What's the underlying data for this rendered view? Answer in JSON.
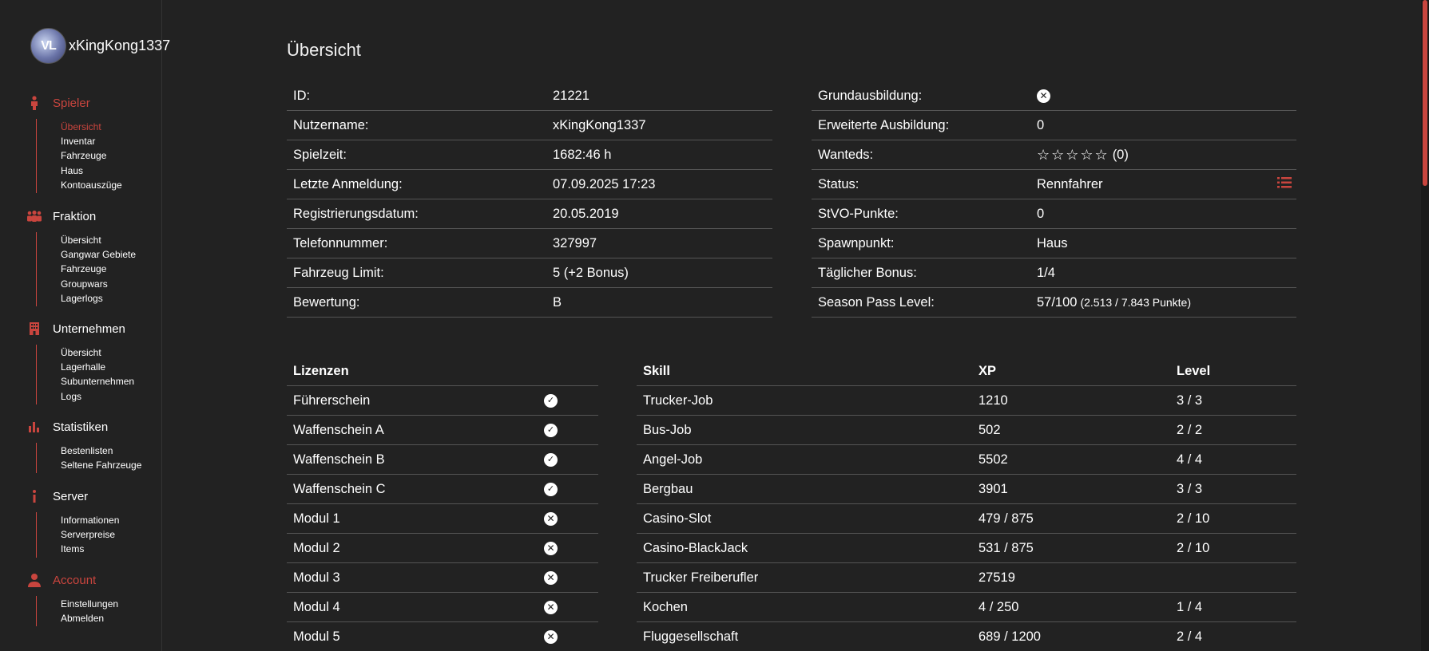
{
  "profile": {
    "avatar_text": "VL",
    "username": "xKingKong1337"
  },
  "sidebar": {
    "spieler": {
      "label": "Spieler",
      "items": [
        "Übersicht",
        "Inventar",
        "Fahrzeuge",
        "Haus",
        "Kontoauszüge"
      ]
    },
    "fraktion": {
      "label": "Fraktion",
      "items": [
        "Übersicht",
        "Gangwar Gebiete",
        "Fahrzeuge",
        "Groupwars",
        "Lagerlogs"
      ]
    },
    "unternehmen": {
      "label": "Unternehmen",
      "items": [
        "Übersicht",
        "Lagerhalle",
        "Subunternehmen",
        "Logs"
      ]
    },
    "statistiken": {
      "label": "Statistiken",
      "items": [
        "Bestenlisten",
        "Seltene Fahrzeuge"
      ]
    },
    "server": {
      "label": "Server",
      "items": [
        "Informationen",
        "Serverpreise",
        "Items"
      ]
    },
    "account": {
      "label": "Account",
      "items": [
        "Einstellungen",
        "Abmelden"
      ]
    }
  },
  "page_title": "Übersicht",
  "info_left": [
    {
      "k": "ID:",
      "v": "21221"
    },
    {
      "k": "Nutzername:",
      "v": "xKingKong1337"
    },
    {
      "k": "Spielzeit:",
      "v": "1682:46 h"
    },
    {
      "k": "Letzte Anmeldung:",
      "v": "07.09.2025 17:23"
    },
    {
      "k": "Registrierungsdatum:",
      "v": "20.05.2019"
    },
    {
      "k": "Telefonnummer:",
      "v": "327997"
    },
    {
      "k": "Fahrzeug Limit:",
      "v": "5 (+2 Bonus)"
    },
    {
      "k": "Bewertung:",
      "v": "B"
    }
  ],
  "info_right": {
    "grundausbildung": {
      "k": "Grundausbildung:",
      "state": "no"
    },
    "erweitert": {
      "k": "Erweiterte Ausbildung:",
      "v": "0"
    },
    "wanteds": {
      "k": "Wanteds:",
      "stars": "☆☆☆☆☆",
      "count": "(0)"
    },
    "status": {
      "k": "Status:",
      "v": "Rennfahrer"
    },
    "stvo": {
      "k": "StVO-Punkte:",
      "v": "0"
    },
    "spawn": {
      "k": "Spawnpunkt:",
      "v": "Haus"
    },
    "bonus": {
      "k": "Täglicher Bonus:",
      "v": "1/4"
    },
    "season": {
      "k": "Season Pass Level:",
      "v": "57/100",
      "extra": "(2.513 / 7.843 Punkte)"
    }
  },
  "lizenzen": {
    "header": "Lizenzen",
    "rows": [
      {
        "name": "Führerschein",
        "state": "yes"
      },
      {
        "name": "Waffenschein A",
        "state": "yes"
      },
      {
        "name": "Waffenschein B",
        "state": "yes"
      },
      {
        "name": "Waffenschein C",
        "state": "yes"
      },
      {
        "name": "Modul 1",
        "state": "no"
      },
      {
        "name": "Modul 2",
        "state": "no"
      },
      {
        "name": "Modul 3",
        "state": "no"
      },
      {
        "name": "Modul 4",
        "state": "no"
      },
      {
        "name": "Modul 5",
        "state": "no"
      }
    ]
  },
  "skills": {
    "headers": {
      "skill": "Skill",
      "xp": "XP",
      "level": "Level"
    },
    "rows": [
      {
        "skill": "Trucker-Job",
        "xp": "1210",
        "level": "3 / 3"
      },
      {
        "skill": "Bus-Job",
        "xp": "502",
        "level": "2 / 2"
      },
      {
        "skill": "Angel-Job",
        "xp": "5502",
        "level": "4 / 4"
      },
      {
        "skill": "Bergbau",
        "xp": "3901",
        "level": "3 / 3"
      },
      {
        "skill": "Casino-Slot",
        "xp": "479 / 875",
        "level": "2 / 10"
      },
      {
        "skill": "Casino-BlackJack",
        "xp": "531 / 875",
        "level": "2 / 10"
      },
      {
        "skill": "Trucker Freiberufler",
        "xp": "27519",
        "level": ""
      },
      {
        "skill": "Kochen",
        "xp": "4 / 250",
        "level": "1 / 4"
      },
      {
        "skill": "Fluggesellschaft",
        "xp": "689 / 1200",
        "level": "2 / 4"
      }
    ]
  },
  "colors": {
    "accent": "#c9453e",
    "background": "#222222",
    "text": "#ffffff",
    "divider": "#555555"
  }
}
